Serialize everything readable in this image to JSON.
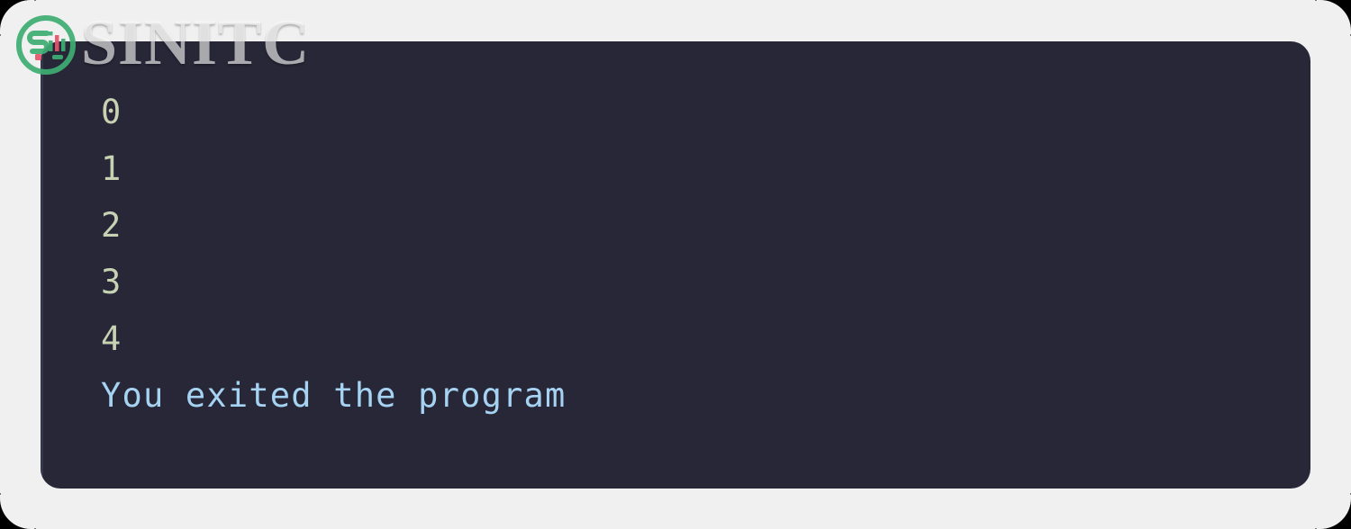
{
  "page": {
    "background_color": "#f0f0f1",
    "outer_color": "#000000"
  },
  "watermark": {
    "text": "SINITC",
    "logo_name": "sinitc-logo",
    "logo_ring_color": "#3fae74",
    "logo_accent_color": "#e8546c",
    "text_color": "rgba(255,255,255,0.62)"
  },
  "console": {
    "background_color": "#272738",
    "output_color": "#c6d2b2",
    "info_color": "#a6d3f2",
    "lines": [
      {
        "text": "0",
        "kind": "out"
      },
      {
        "text": "1",
        "kind": "out"
      },
      {
        "text": "2",
        "kind": "out"
      },
      {
        "text": "3",
        "kind": "out"
      },
      {
        "text": "4",
        "kind": "out"
      },
      {
        "text": "You exited the program",
        "kind": "info"
      }
    ]
  }
}
